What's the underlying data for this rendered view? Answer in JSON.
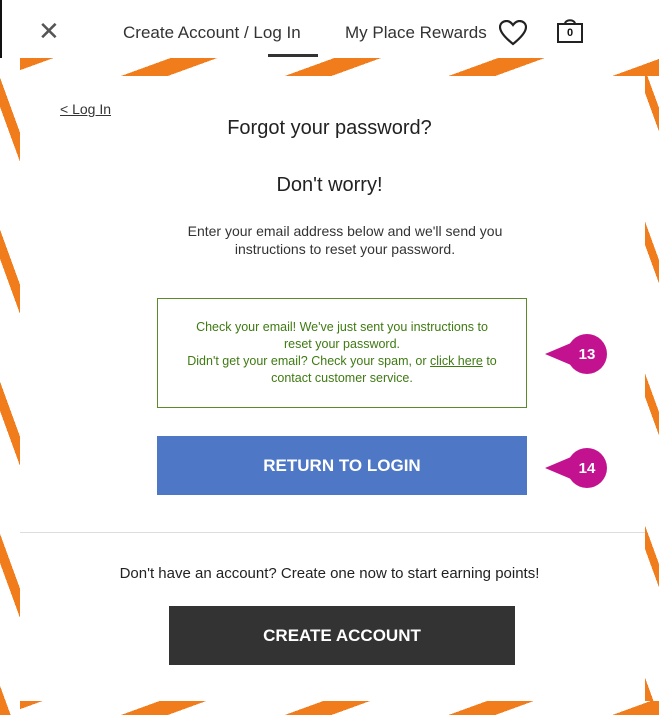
{
  "header": {
    "close_icon": "close-icon",
    "create_account_login": "Create Account / Log In",
    "rewards": "My Place Rewards",
    "heart_icon": "heart-icon",
    "bag_icon": "shopping-bag-icon",
    "bag_count": "0"
  },
  "modal": {
    "back_link": "< Log In",
    "title": "Forgot your password?",
    "subtitle": "Don't worry!",
    "instructions": "Enter your email address below and we'll send you instructions to reset your password.",
    "notice": {
      "line1": "Check your email! We've just sent you instructions to reset your password.",
      "line2_prefix": "Didn't get your email? Check your spam, or",
      "link_text": "click here",
      "line2_suffix": "to contact customer service."
    },
    "return_button": "RETURN TO LOGIN",
    "no_account_text": "Don't have an account? Create one now to start earning points!",
    "create_button": "CREATE ACCOUNT"
  },
  "annotations": {
    "callout_13": "13",
    "callout_14": "14"
  },
  "colors": {
    "stripe_orange": "#f07c1c",
    "primary_blue": "#4e77c6",
    "dark_button": "#333333",
    "notice_green": "#3f7a12",
    "callout_magenta": "#c3128f"
  }
}
